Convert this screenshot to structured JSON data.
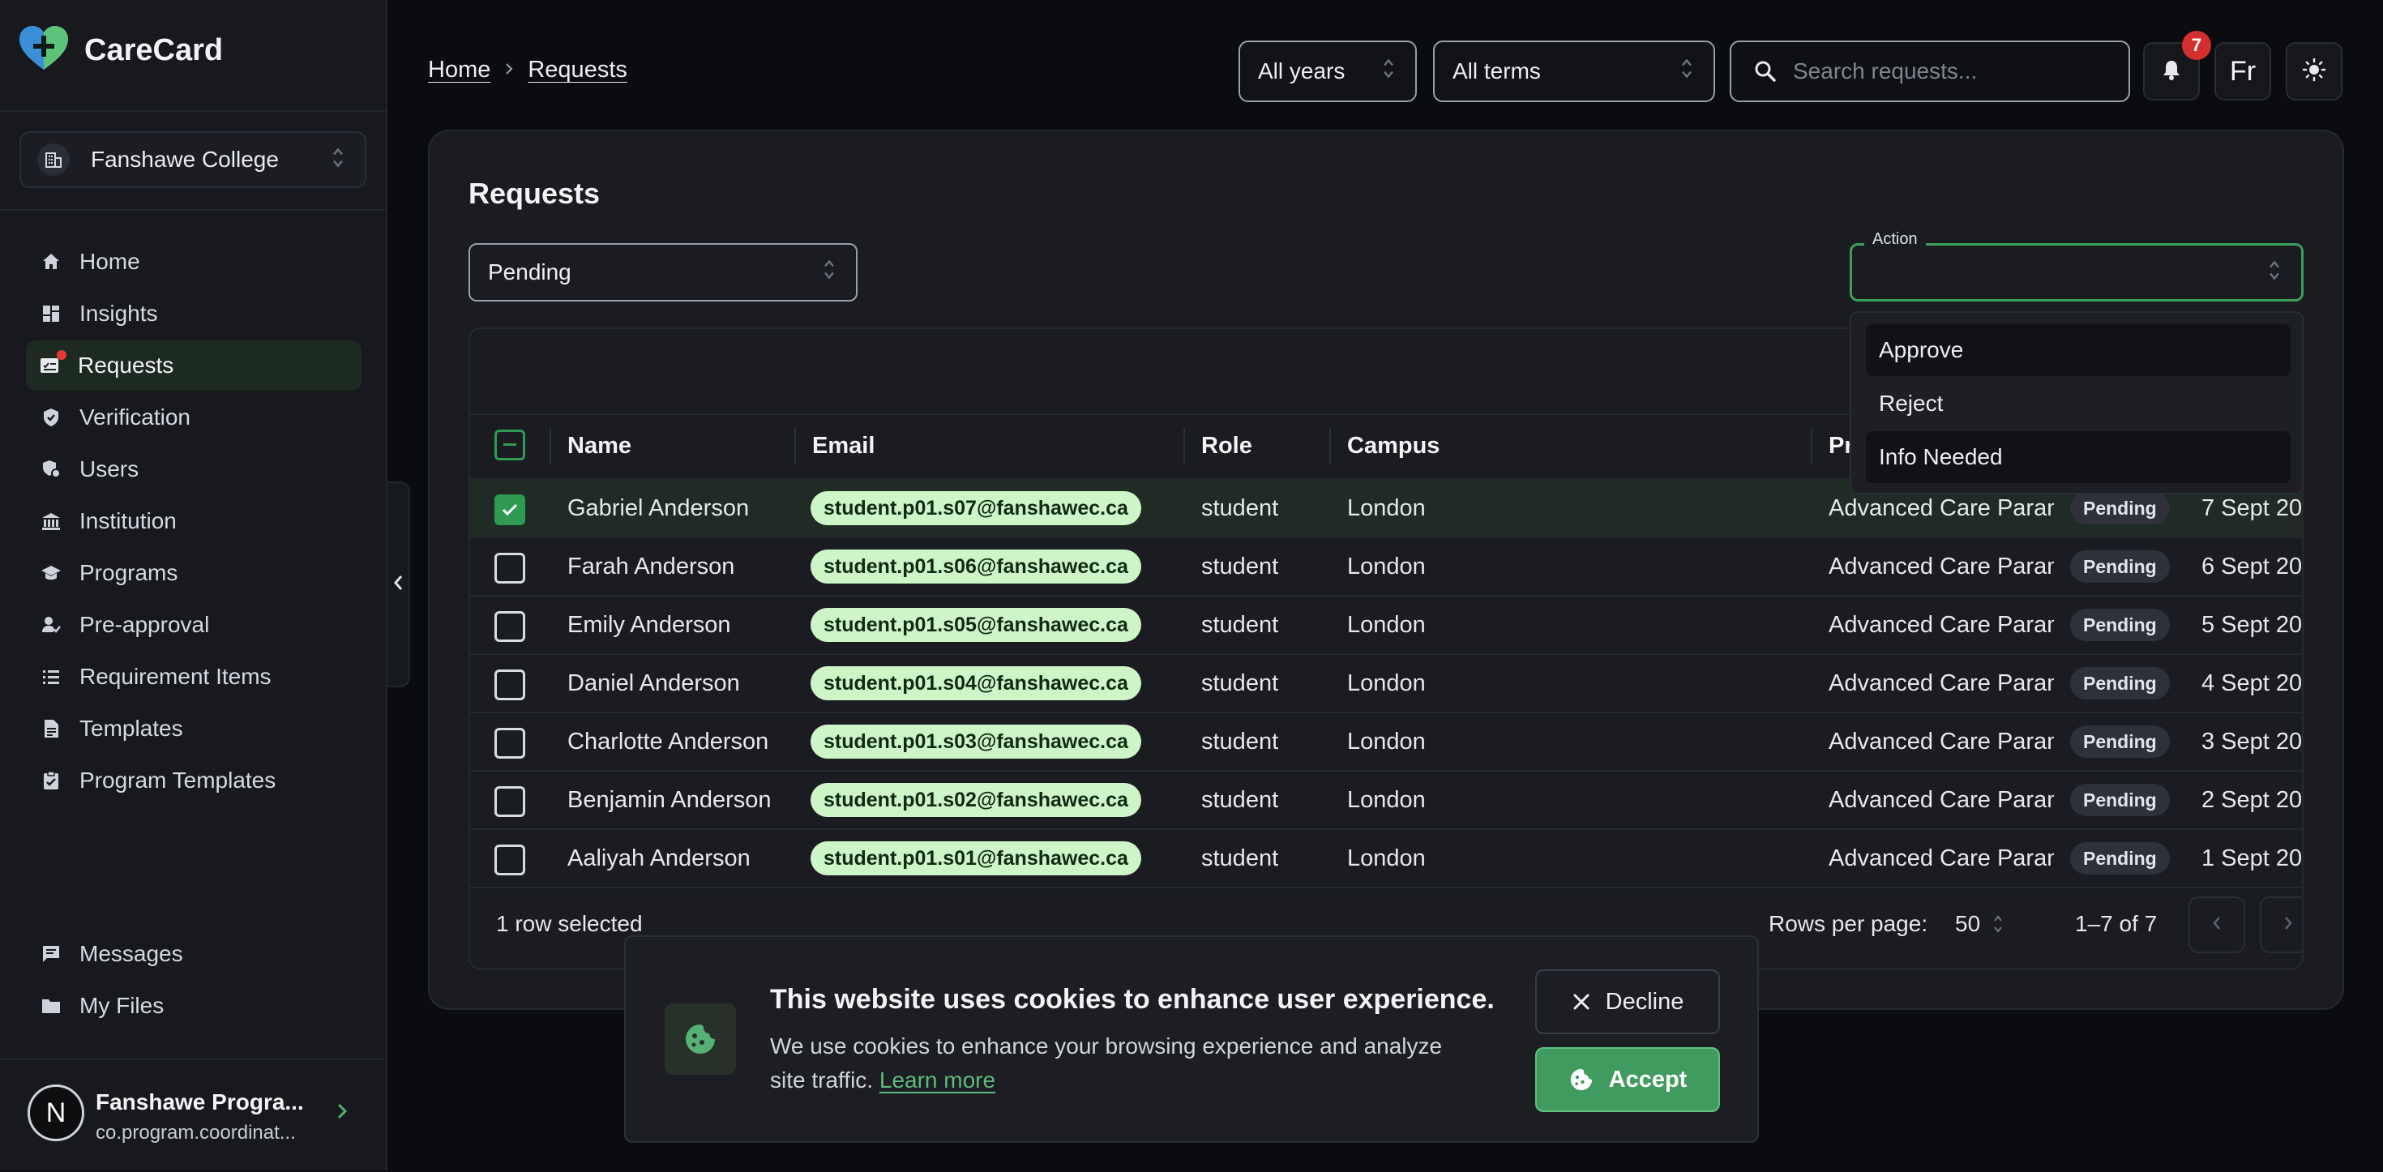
{
  "app": {
    "name": "CareCard",
    "accent": "#2f9a52"
  },
  "institution": {
    "label": "Fanshawe College"
  },
  "nav": {
    "items": [
      {
        "label": "Home",
        "icon": "home-icon"
      },
      {
        "label": "Insights",
        "icon": "dashboard-icon"
      },
      {
        "label": "Requests",
        "icon": "requests-icon",
        "active": true
      },
      {
        "label": "Verification",
        "icon": "shield-check-icon"
      },
      {
        "label": "Users",
        "icon": "users-icon"
      },
      {
        "label": "Institution",
        "icon": "bank-icon"
      },
      {
        "label": "Programs",
        "icon": "graduation-icon"
      },
      {
        "label": "Pre-approval",
        "icon": "user-check-icon"
      },
      {
        "label": "Requirement Items",
        "icon": "list-icon"
      },
      {
        "label": "Templates",
        "icon": "document-icon"
      },
      {
        "label": "Program Templates",
        "icon": "clipboard-check-icon"
      }
    ],
    "bottom": [
      {
        "label": "Messages",
        "icon": "message-icon"
      },
      {
        "label": "My Files",
        "icon": "folder-icon"
      }
    ]
  },
  "user": {
    "initial": "N",
    "name": "Fanshawe Progra...",
    "email": "co.program.coordinat..."
  },
  "header": {
    "breadcrumb": [
      "Home",
      "Requests"
    ],
    "year_select": "All years",
    "term_select": "All terms",
    "search_placeholder": "Search requests...",
    "notification_count": "7",
    "language": "Fr"
  },
  "page": {
    "title": "Requests",
    "status_filter": "Pending",
    "action": {
      "legend": "Action",
      "options": [
        "Approve",
        "Reject",
        "Info Needed"
      ]
    }
  },
  "table": {
    "columns": [
      "Name",
      "Email",
      "Role",
      "Campus",
      "Pr"
    ],
    "rows": [
      {
        "selected": true,
        "name": "Gabriel Anderson",
        "email": "student.p01.s07@fanshawec.ca",
        "role": "student",
        "campus": "London",
        "program": "Advanced Care Param",
        "status": "Pending",
        "date": "7 Sept 20"
      },
      {
        "selected": false,
        "name": "Farah Anderson",
        "email": "student.p01.s06@fanshawec.ca",
        "role": "student",
        "campus": "London",
        "program": "Advanced Care Param",
        "status": "Pending",
        "date": "6 Sept 20"
      },
      {
        "selected": false,
        "name": "Emily Anderson",
        "email": "student.p01.s05@fanshawec.ca",
        "role": "student",
        "campus": "London",
        "program": "Advanced Care Param",
        "status": "Pending",
        "date": "5 Sept 20"
      },
      {
        "selected": false,
        "name": "Daniel Anderson",
        "email": "student.p01.s04@fanshawec.ca",
        "role": "student",
        "campus": "London",
        "program": "Advanced Care Param",
        "status": "Pending",
        "date": "4 Sept 20"
      },
      {
        "selected": false,
        "name": "Charlotte Anderson",
        "email": "student.p01.s03@fanshawec.ca",
        "role": "student",
        "campus": "London",
        "program": "Advanced Care Param",
        "status": "Pending",
        "date": "3 Sept 20"
      },
      {
        "selected": false,
        "name": "Benjamin Anderson",
        "email": "student.p01.s02@fanshawec.ca",
        "role": "student",
        "campus": "London",
        "program": "Advanced Care Param",
        "status": "Pending",
        "date": "2 Sept 20"
      },
      {
        "selected": false,
        "name": "Aaliyah Anderson",
        "email": "student.p01.s01@fanshawec.ca",
        "role": "student",
        "campus": "London",
        "program": "Advanced Care Param",
        "status": "Pending",
        "date": "1 Sept 20"
      }
    ],
    "footer": {
      "selected_text": "1 row selected",
      "rows_per_page_label": "Rows per page:",
      "rows_per_page": "50",
      "range": "1–7 of 7"
    }
  },
  "cookie": {
    "title": "This website uses cookies to enhance user experience.",
    "body": "We use cookies to enhance your browsing experience and analyze site traffic.",
    "link": "Learn more",
    "decline": "Decline",
    "accept": "Accept"
  }
}
